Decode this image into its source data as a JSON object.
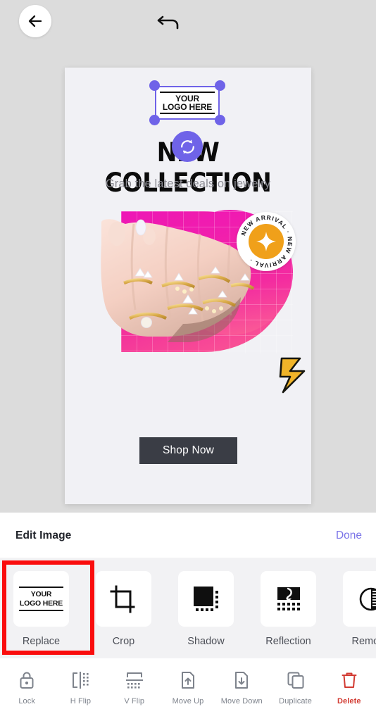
{
  "topbar": {
    "back_icon": "arrow-left-icon",
    "undo_icon": "undo-arrow-icon"
  },
  "canvas": {
    "selected_element": {
      "type": "logo-placeholder",
      "line1": "YOUR",
      "line2": "LOGO HERE",
      "handle_color": "#6f63e8",
      "rotate_icon": "rotate-refresh-icon"
    },
    "headline": "NEW COLLECTION",
    "subhead": "Grab the latest deals on jewelry",
    "badge": {
      "text": "NEW ARRIVAL · NEW ARRIVAL ·",
      "star_icon": "four-point-star-icon",
      "core_color": "#f0a01a"
    },
    "shop_button": "Shop Now",
    "accent_pink": "#ef17b5",
    "bolt_color": "#f0b429",
    "background": "#f1f1f5"
  },
  "sheet": {
    "title": "Edit Image",
    "done_label": "Done",
    "done_color": "#7b74e8",
    "tools": [
      {
        "label": "Replace",
        "icon": "replace-logo-icon",
        "highlighted": true,
        "logo_line1": "YOUR",
        "logo_line2": "LOGO HERE"
      },
      {
        "label": "Crop",
        "icon": "crop-icon",
        "highlighted": false
      },
      {
        "label": "Shadow",
        "icon": "shadow-icon",
        "highlighted": false
      },
      {
        "label": "Reflection",
        "icon": "reflection-icon",
        "highlighted": false
      },
      {
        "label": "Remove",
        "icon": "remove-contrast-icon",
        "highlighted": false
      }
    ]
  },
  "bottombar": {
    "items": [
      {
        "label": "Lock",
        "icon": "lock-icon",
        "danger": false
      },
      {
        "label": "H Flip",
        "icon": "flip-horizontal-icon",
        "danger": false
      },
      {
        "label": "V Flip",
        "icon": "flip-vertical-icon",
        "danger": false
      },
      {
        "label": "Move Up",
        "icon": "move-up-icon",
        "danger": false
      },
      {
        "label": "Move Down",
        "icon": "move-down-icon",
        "danger": false
      },
      {
        "label": "Duplicate",
        "icon": "duplicate-icon",
        "danger": false
      },
      {
        "label": "Delete",
        "icon": "trash-icon",
        "danger": true
      }
    ],
    "danger_color": "#d23b32"
  },
  "annotation": {
    "highlight_color": "#fa0d0d",
    "target": "Replace"
  }
}
